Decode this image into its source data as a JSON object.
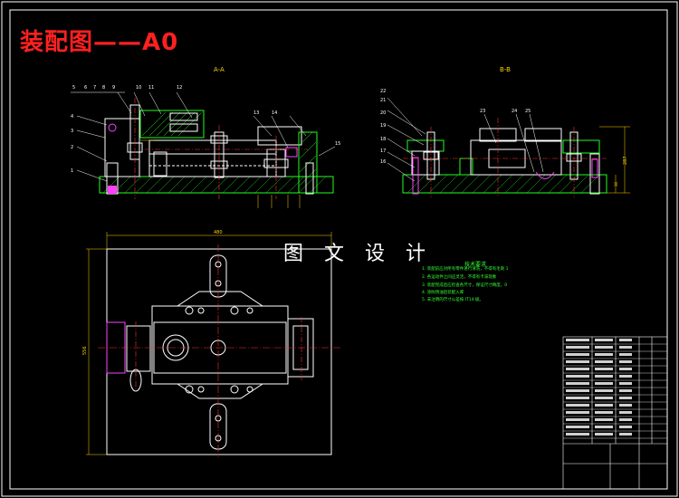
{
  "drawing": {
    "title": "装配图——A0",
    "watermark": "图 文 设 计",
    "section_a_label": "A-A",
    "section_b_label": "B-B",
    "view_a_callouts": [
      "1",
      "2",
      "3",
      "4",
      "5",
      "6",
      "7",
      "8",
      "9",
      "10",
      "11",
      "12",
      "13",
      "14",
      "15"
    ],
    "view_b_callouts": [
      "16",
      "17",
      "18",
      "19",
      "20",
      "21",
      "22",
      "23",
      "24",
      "25"
    ],
    "dimensions": {
      "plan_width": "480",
      "plan_height": "556",
      "b_height": "287",
      "b_sub": "30"
    },
    "technical_notes": {
      "title": "技术要求",
      "lines": [
        "1. 装配前应对所有零件进行清洗，不得有毛刺 1",
        "2. 各运动件之间应灵活，不得有卡滞现象",
        "3. 装配完成后应检查各尺寸，保证尺寸精度，0",
        "4. 涂防锈油后装配入库",
        "5. 未注明的尺寸公差按 IT14 级。"
      ]
    },
    "title_block_rows": 14,
    "colors": {
      "background": "#000000",
      "frame": "#ffffff",
      "part": "#ffffff",
      "section": "#20ff20",
      "center": "#ff3030",
      "dimension": "#ffd400",
      "highlight": "#ff40ff",
      "hatch": "#ffff60"
    }
  }
}
